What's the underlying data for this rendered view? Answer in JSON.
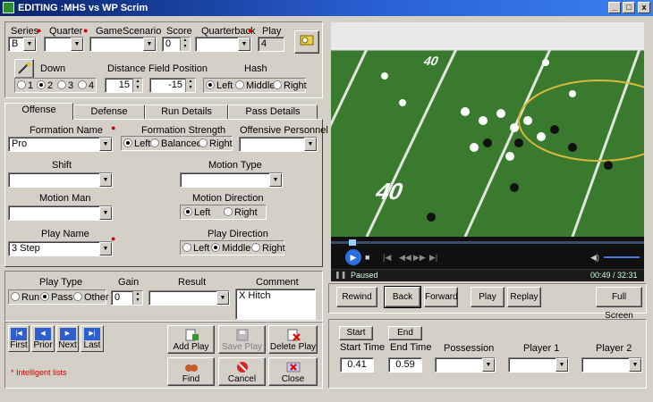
{
  "window": {
    "title": "EDITING :MHS vs WP Scrim",
    "min": "_",
    "max": "□",
    "close": "x"
  },
  "top": {
    "series_label": "Series",
    "series_value": "B",
    "quarter_label": "Quarter",
    "quarter_value": "",
    "scenario_label": "GameScenario",
    "scenario_value": "",
    "score_label": "Score",
    "score_value": "0",
    "qb_label": "Quarterback",
    "qb_value": "",
    "play_label": "Play",
    "play_value": "4",
    "down_label": "Down",
    "down_options": [
      "1",
      "2",
      "3",
      "4"
    ],
    "down_selected": "2",
    "distance_label": "Distance",
    "distance_value": "15",
    "fieldpos_label": "Field Position",
    "fieldpos_value": "-15",
    "hash_label": "Hash",
    "hash_options": [
      "Left",
      "Middle",
      "Right"
    ],
    "hash_selected": "Left"
  },
  "tabs": [
    "Offense",
    "Defense",
    "Run Details",
    "Pass Details"
  ],
  "offense": {
    "formation_label": "Formation Name",
    "formation_value": "Pro",
    "strength_label": "Formation Strength",
    "strength_options": [
      "Left",
      "Balanced",
      "Right"
    ],
    "strength_selected": "Left",
    "personnel_label": "Offensive Personnel",
    "personnel_value": "",
    "shift_label": "Shift",
    "shift_value": "",
    "motion_type_label": "Motion Type",
    "motion_type_value": "",
    "motion_man_label": "Motion Man",
    "motion_man_value": "",
    "motion_dir_label": "Motion Direction",
    "motion_dir_options": [
      "Left",
      "Right"
    ],
    "motion_dir_selected": "Left",
    "play_name_label": "Play Name",
    "play_name_value": "3 Step",
    "play_dir_label": "Play Direction",
    "play_dir_options": [
      "Left",
      "Middle",
      "Right"
    ],
    "play_dir_selected": "Middle"
  },
  "result": {
    "play_type_label": "Play Type",
    "play_type_options": [
      "Run",
      "Pass",
      "Other"
    ],
    "play_type_selected": "Pass",
    "gain_label": "Gain",
    "gain_value": "0",
    "result_label": "Result",
    "result_value": "",
    "comment_label": "Comment",
    "comment_value": "X Hitch"
  },
  "nav": [
    "First",
    "Prior",
    "Next",
    "Last"
  ],
  "actions": {
    "add": "Add Play",
    "save": "Save Play",
    "delete": "Delete Play",
    "find": "Find",
    "cancel": "Cancel",
    "close": "Close"
  },
  "note": "* Intelligent lists",
  "player": {
    "status": "Paused",
    "time": "00:49 / 32:31"
  },
  "video_controls": [
    "Rewind",
    "Back",
    "Forward",
    "Play",
    "Replay",
    "Full Screen"
  ],
  "clip": {
    "start_btn": "Start",
    "end_btn": "End",
    "start_label": "Start Time",
    "end_label": "End Time",
    "start_value": "0.41",
    "end_value": "0.59",
    "possession_label": "Possession",
    "player1_label": "Player 1",
    "player2_label": "Player 2"
  },
  "video": {
    "yard_left": "40",
    "yard_mid": "40"
  },
  "colors": {
    "title_start": "#0a246a",
    "title_end": "#3a80f0",
    "field": "#2e6b2a",
    "required": "#cc0000"
  }
}
